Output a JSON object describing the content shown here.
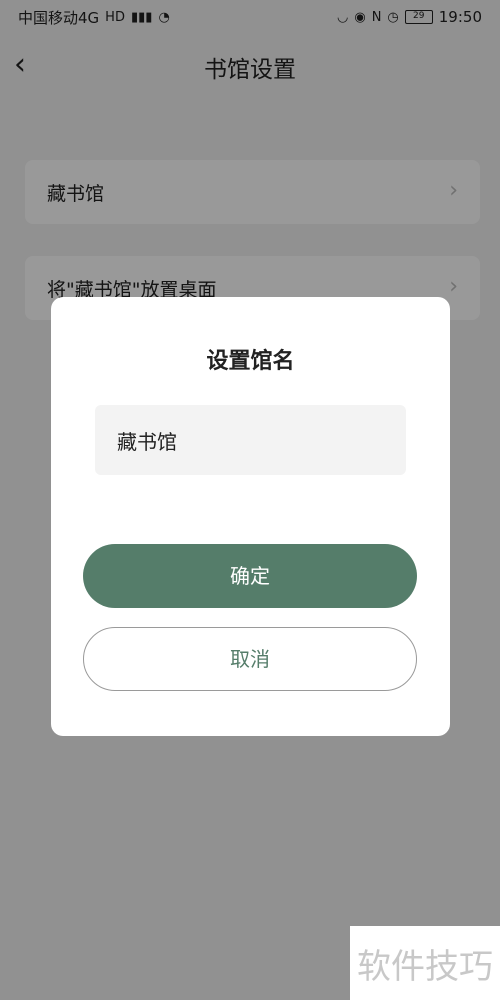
{
  "status_bar": {
    "carrier": "中国移动4G",
    "hd_badge": "HD",
    "network": "4G",
    "battery": "29",
    "time": "19:50"
  },
  "nav": {
    "title": "书馆设置"
  },
  "settings": {
    "items": [
      {
        "label": "藏书馆"
      },
      {
        "label": "将\"藏书馆\"放置桌面"
      }
    ]
  },
  "dialog": {
    "title": "设置馆名",
    "input_value": "藏书馆",
    "confirm_label": "确定",
    "cancel_label": "取消"
  },
  "watermark": {
    "text": "软件技巧"
  },
  "colors": {
    "accent": "#557d6a",
    "overlay": "rgba(0,0,0,0.40)"
  }
}
